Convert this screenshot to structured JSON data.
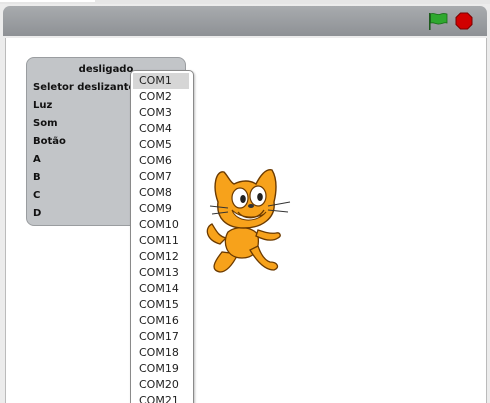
{
  "panel": {
    "title": "desligado",
    "sensors": [
      "Seletor deslizante",
      "Luz",
      "Som",
      "Botão",
      "A",
      "B",
      "C",
      "D"
    ]
  },
  "dropdown": {
    "selected": "COM1",
    "options": [
      "COM1",
      "COM2",
      "COM3",
      "COM4",
      "COM5",
      "COM6",
      "COM7",
      "COM8",
      "COM9",
      "COM10",
      "COM11",
      "COM12",
      "COM13",
      "COM14",
      "COM15",
      "COM16",
      "COM17",
      "COM18",
      "COM19",
      "COM20",
      "COM21"
    ]
  },
  "icons": {
    "flag": "green-flag-icon",
    "stop": "stop-icon"
  },
  "colors": {
    "flag": "#2fa82f",
    "stop": "#d10000",
    "cat": "#f7a21b"
  }
}
